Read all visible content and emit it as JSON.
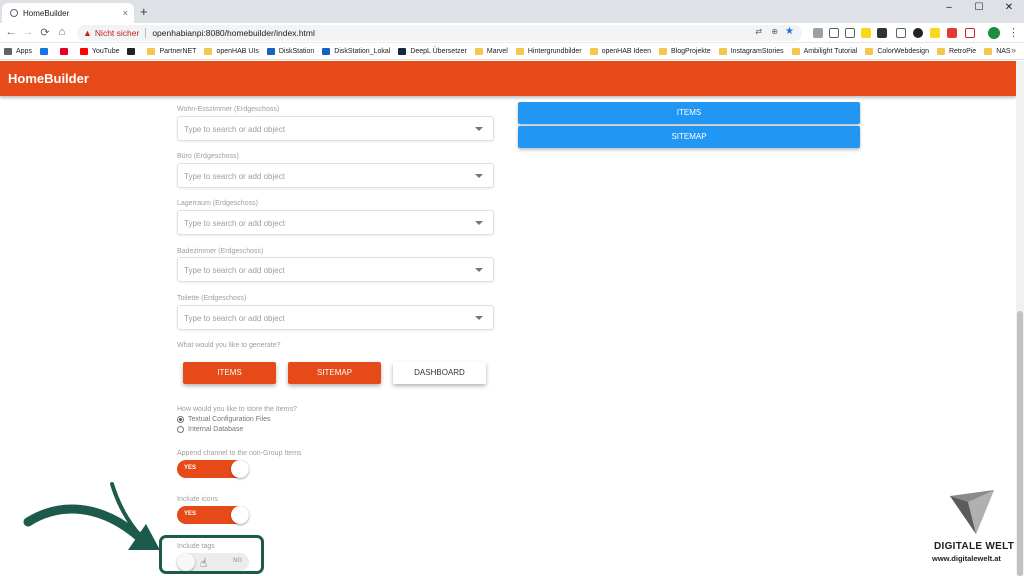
{
  "browser": {
    "tab_title": "HomeBuilder",
    "tab_close": "×",
    "new_tab": "+",
    "window_controls": [
      "–",
      "☐",
      "✕"
    ],
    "not_secure_label": "Nicht sicher",
    "url": "openhabianpi:8080/homebuilder/index.html",
    "nav": {
      "back": "←",
      "forward": "→",
      "reload": "⟳",
      "home": "⌂"
    },
    "bookmarks": [
      {
        "label": "Apps",
        "color": "#5f6368"
      },
      {
        "label": "",
        "color": "#1a73e8"
      },
      {
        "label": "",
        "color": "#e60023"
      },
      {
        "label": "YouTube",
        "color": "#ff0000"
      },
      {
        "label": "",
        "color": "#222222"
      },
      {
        "label": "PartnerNET",
        "color": "#f4c84f"
      },
      {
        "label": "openHAB UIs",
        "color": "#f4c84f"
      },
      {
        "label": "DiskStation",
        "color": "#1565c0"
      },
      {
        "label": "DiskStation_Lokal",
        "color": "#1565c0"
      },
      {
        "label": "DeepL Übersetzer",
        "color": "#0f2b46"
      },
      {
        "label": "Marvel",
        "color": "#f4c84f"
      },
      {
        "label": "Hintergrundbilder",
        "color": "#f4c84f"
      },
      {
        "label": "openHAB Ideen",
        "color": "#f4c84f"
      },
      {
        "label": "BlogProjekte",
        "color": "#f4c84f"
      },
      {
        "label": "InstagramStories",
        "color": "#f4c84f"
      },
      {
        "label": "Ambilight Tutorial",
        "color": "#f4c84f"
      },
      {
        "label": "ColorWebdesign",
        "color": "#f4c84f"
      },
      {
        "label": "RetroPie",
        "color": "#f4c84f"
      },
      {
        "label": "NAS",
        "color": "#f4c84f"
      }
    ],
    "bookmarks_more": "»"
  },
  "app": {
    "title": "HomeBuilder",
    "accent_color": "#e64a19",
    "blue_color": "#2196f3"
  },
  "rooms": [
    {
      "label": "Wohn-Esszimmer (Erdgeschoss)",
      "placeholder": "Type to search or add object"
    },
    {
      "label": "Büro (Erdgeschoss)",
      "placeholder": "Type to search or add object"
    },
    {
      "label": "Lagerraum (Erdgeschoss)",
      "placeholder": "Type to search or add object"
    },
    {
      "label": "Badezimmer (Erdgeschoss)",
      "placeholder": "Type to search or add object"
    },
    {
      "label": "Toilette (Erdgeschoss)",
      "placeholder": "Type to search or add object"
    }
  ],
  "right_panel": {
    "items_button": "ITEMS",
    "sitemap_button": "SITEMAP"
  },
  "generate": {
    "question": "What would you like to generate?",
    "buttons": [
      {
        "label": "ITEMS",
        "selected": true
      },
      {
        "label": "SITEMAP",
        "selected": true
      },
      {
        "label": "DASHBOARD",
        "selected": false
      }
    ]
  },
  "storage": {
    "question": "How would you like to store the Items?",
    "options": [
      {
        "label": "Textual Configuration Files",
        "checked": true
      },
      {
        "label": "Internal Database",
        "checked": false
      }
    ]
  },
  "toggles": [
    {
      "label": "Append channel to the non-Group Items",
      "state": "YES",
      "on": true
    },
    {
      "label": "Include icons",
      "state": "YES",
      "on": true
    },
    {
      "label": "Include tags",
      "state": "NO",
      "on": false
    }
  ],
  "watermark": {
    "brand": "DIGITALE WELT",
    "url": "www.digitalewelt.at"
  }
}
